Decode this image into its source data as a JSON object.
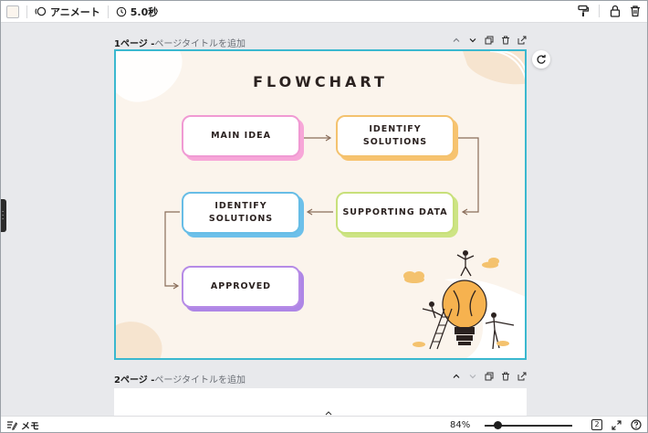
{
  "toolbar": {
    "animate_label": "アニメート",
    "duration_label": "5.0秒"
  },
  "pages": [
    {
      "number_label": "1ページ - ",
      "title_placeholder": "ページタイトルを追加"
    },
    {
      "number_label": "2ページ - ",
      "title_placeholder": "ページタイトルを追加"
    }
  ],
  "flowchart": {
    "title": "FLOWCHART",
    "boxes": {
      "main_idea": "MAIN IDEA",
      "identify_solutions_1": "IDENTIFY SOLUTIONS",
      "supporting_data": "SUPPORTING DATA",
      "identify_solutions_2": "IDENTIFY SOLUTIONS",
      "approved": "APPROVED"
    }
  },
  "bottombar": {
    "memo_label": "メモ",
    "zoom_label": "84%",
    "zoom_value": 0.84,
    "page_count": "2"
  },
  "colors": {
    "canvas_bg": "#fbf4ec",
    "selection": "#3ab8cf",
    "pink": "#f09ad3",
    "orange": "#f4c26e",
    "blue": "#67bde6",
    "green": "#c8e07a",
    "purple": "#b68be6"
  }
}
